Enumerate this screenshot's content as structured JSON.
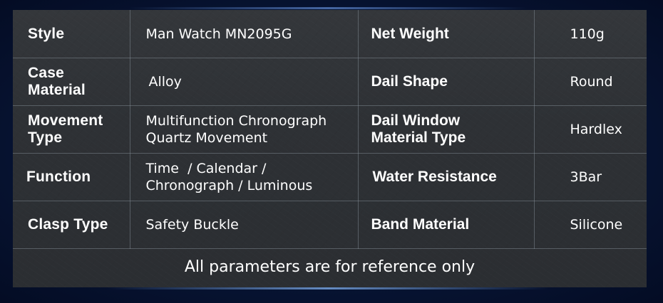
{
  "specs": {
    "rows": [
      {
        "left_key": [
          "Style"
        ],
        "left_value": [
          "Man Watch MN2095G"
        ],
        "right_key": [
          "Net Weight"
        ],
        "right_value": [
          "110g"
        ]
      },
      {
        "left_key": [
          "Case",
          "Material"
        ],
        "left_value": [
          "Alloy"
        ],
        "right_key": [
          "Dail Shape"
        ],
        "right_value": [
          "Round"
        ]
      },
      {
        "left_key": [
          "Movement",
          "Type"
        ],
        "left_value": [
          "Multifunction Chronograph",
          "Quartz Movement"
        ],
        "right_key": [
          "Dail Window",
          "Material Type"
        ],
        "right_value": [
          "Hardlex"
        ]
      },
      {
        "left_key": [
          "Function"
        ],
        "left_value": [
          "Time  / Calendar /",
          "Chronograph / Luminous"
        ],
        "right_key": [
          "Water Resistance"
        ],
        "right_value": [
          "3Bar"
        ]
      },
      {
        "left_key": [
          "Clasp Type"
        ],
        "left_value": [
          "Safety Buckle"
        ],
        "right_key": [
          "Band Material"
        ],
        "right_value": [
          "Silicone"
        ]
      }
    ]
  },
  "footer": {
    "note": "All parameters are for reference only"
  }
}
